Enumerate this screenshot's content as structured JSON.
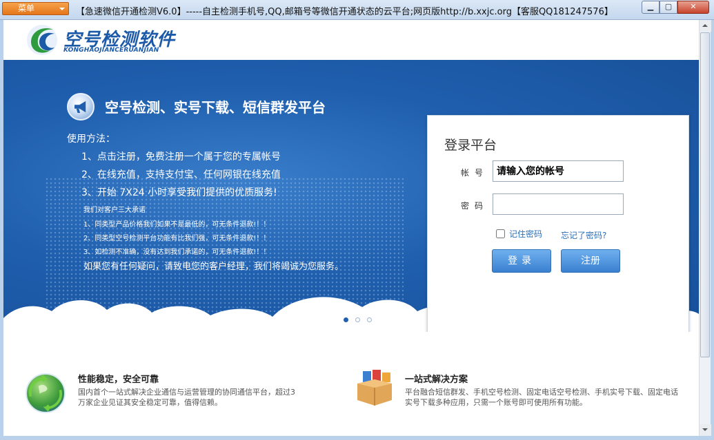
{
  "window": {
    "menu_label": "菜单",
    "title": "【急速微信开通检测V6.0】-----自主检测手机号,QQ,邮箱号等微信开通状态的云平台;网页版http://b.xxjc.org【客服QQ181247576】",
    "min_symbol": "▁",
    "max_symbol": "▢",
    "close_symbol": "✕"
  },
  "header": {
    "logo_title": "空号检测软件",
    "logo_subtitle": "KONGHAOJIANCERUANJIAN"
  },
  "banner": {
    "slogan": "空号检测、实号下载、短信群发平台",
    "usage_title": "使用方法：",
    "steps": [
      "1、点击注册，免费注册一个属于您的专属帐号",
      "2、在线充值，支持支付宝、任何网银在线充值",
      "3、开始 7X24 小时享受我们提供的优质服务!"
    ],
    "promise_title": "我们对客户三大承诺",
    "promises": [
      "1、同类型产品价格我们如果不是最低的，可无条件退款!！！",
      "2、同类型空号检测平台功能有比我们强，可无条件退款!！！",
      "3、如检测不准确，没有达到我们承诺的，可无条件退款!！！"
    ],
    "contact": "如果您有任何疑问，请致电您的客户经理，我们将竭诚为您服务。",
    "slide_count": 3,
    "active_slide": 1
  },
  "login": {
    "title": "登录平台",
    "username_label": "帐号",
    "username_placeholder": "请输入您的帐号",
    "password_label": "密码",
    "remember_label": "记住密码",
    "forgot_label": "忘记了密码?",
    "login_button": "登录",
    "register_button": "注册"
  },
  "features": [
    {
      "title": "性能稳定，安全可靠",
      "text": "国内首个一站式解决企业通信与运营管理的协同通信平台，超过3万家企业见证其安全稳定可靠，值得信赖。",
      "icon": "globe-icon"
    },
    {
      "title": "一站式解决方案",
      "text": "平台融合短信群发、手机空号检测、固定电话空号检测、手机实号下载、固定电话实号下载多种应用，只需一个账号即可使用所有功能。",
      "icon": "package-icon"
    }
  ],
  "colors": {
    "banner_blue": "#1f5fae",
    "accent_orange": "#e4761a",
    "link_blue": "#2a6fb7"
  }
}
